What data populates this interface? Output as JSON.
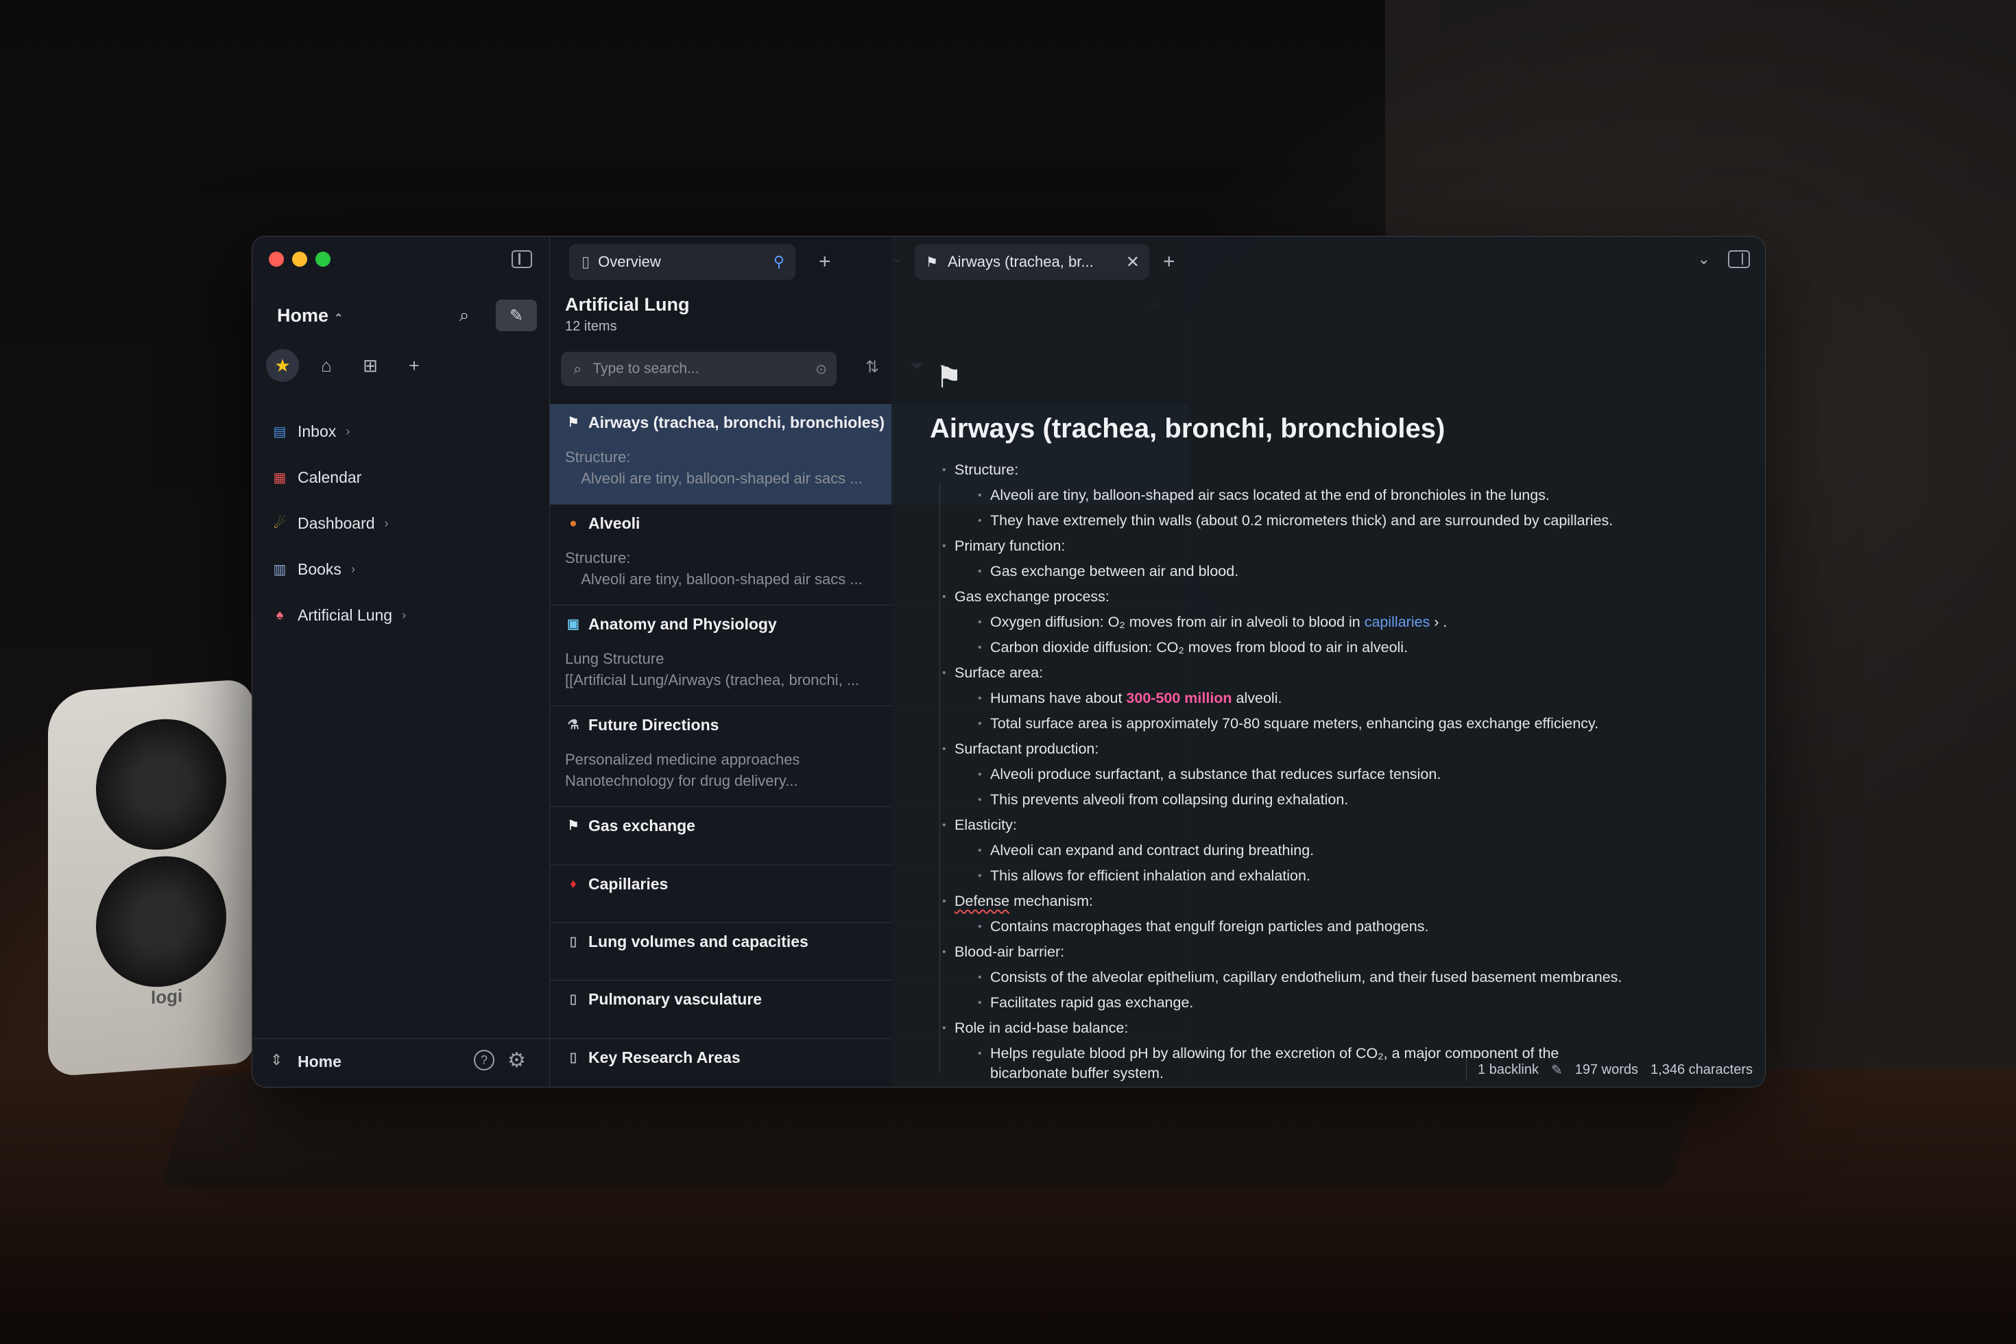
{
  "sidebar": {
    "title": "Home",
    "quick_icons": [
      "star-icon",
      "home-icon",
      "grid-icon",
      "plus-icon"
    ],
    "items": [
      {
        "label": "Inbox",
        "icon": "inbox-icon"
      },
      {
        "label": "Calendar",
        "icon": "calendar-icon"
      },
      {
        "label": "Dashboard",
        "icon": "dashboard-icon"
      },
      {
        "label": "Books",
        "icon": "book-icon"
      },
      {
        "label": "Artificial Lung",
        "icon": "lungs-icon"
      }
    ],
    "footer_label": "Home"
  },
  "middle": {
    "tab_label": "Overview",
    "list_title": "Artificial Lung",
    "list_count": "12 items",
    "search_placeholder": "Type to search...",
    "notes": [
      {
        "title": "Airways (trachea, bronchi, bronchioles)",
        "preview": "Structure:\n    Alveoli are tiny, balloon-shaped air sacs ...",
        "icon": "flag-icon"
      },
      {
        "title": "Alveoli",
        "preview": "Structure:\n    Alveoli are tiny, balloon-shaped air sacs ...",
        "icon": "orange-dot-icon"
      },
      {
        "title": "Anatomy and Physiology",
        "preview": "Lung Structure\n[[Artificial Lung/Airways (trachea, bronchi, ...",
        "icon": "anatomy-icon"
      },
      {
        "title": "Future Directions",
        "preview": "Personalized medicine approaches\nNanotechnology for drug delivery...",
        "icon": "microscope-icon"
      },
      {
        "title": "Gas exchange",
        "preview": "",
        "icon": "flag-icon"
      },
      {
        "title": "Capillaries",
        "preview": "",
        "icon": "drop-icon"
      },
      {
        "title": "Lung volumes and capacities",
        "preview": "",
        "icon": "document-icon"
      },
      {
        "title": "Pulmonary vasculature",
        "preview": "",
        "icon": "document-icon"
      },
      {
        "title": "Key Research Areas",
        "preview": "",
        "icon": "document-icon"
      }
    ]
  },
  "editor": {
    "tab_label": "Airways (trachea, br...",
    "title": "Airways (trachea, bronchi, bronchioles)",
    "outline": [
      {
        "level": 1,
        "text": "Structure:"
      },
      {
        "level": 2,
        "text": "Alveoli are tiny, balloon-shaped air sacs located at the end of bronchioles in the lungs."
      },
      {
        "level": 2,
        "text": "They have extremely thin walls (about 0.2 micrometers thick) and are surrounded by capillaries."
      },
      {
        "level": 1,
        "text": "Primary function:"
      },
      {
        "level": 2,
        "text": "Gas exchange between air and blood."
      },
      {
        "level": 1,
        "text": "Gas exchange process:"
      },
      {
        "level": 2,
        "text": "Oxygen diffusion: O₂ moves from air in alveoli to blood in ",
        "link": "capillaries",
        "after": " ›  ."
      },
      {
        "level": 2,
        "text": "Carbon dioxide diffusion: CO₂ moves from blood to air in alveoli."
      },
      {
        "level": 1,
        "text": "Surface area:"
      },
      {
        "level": 2,
        "text": "Humans have about ",
        "highlight": "300-500 million",
        "after": " alveoli."
      },
      {
        "level": 2,
        "text": "Total surface area is approximately 70-80 square meters, enhancing gas exchange efficiency."
      },
      {
        "level": 1,
        "text": "Surfactant production:"
      },
      {
        "level": 2,
        "text": "Alveoli produce surfactant, a substance that reduces surface tension."
      },
      {
        "level": 2,
        "text": "This prevents alveoli from collapsing during exhalation."
      },
      {
        "level": 1,
        "text": "Elasticity:"
      },
      {
        "level": 2,
        "text": "Alveoli can expand and contract during breathing."
      },
      {
        "level": 2,
        "text": "This allows for efficient inhalation and exhalation."
      },
      {
        "level": 1,
        "underline": "Defense",
        "text": " mechanism:"
      },
      {
        "level": 2,
        "text": "Contains macrophages that engulf foreign particles and pathogens."
      },
      {
        "level": 1,
        "text": "Blood-air barrier:"
      },
      {
        "level": 2,
        "text": "Consists of the alveolar epithelium, capillary endothelium, and their fused basement membranes."
      },
      {
        "level": 2,
        "text": "Facilitates rapid gas exchange."
      },
      {
        "level": 1,
        "text": "Role in acid-base balance:"
      },
      {
        "level": 2,
        "text": "Helps regulate blood pH by allowing for the excretion of CO₂, a major component of the"
      },
      {
        "level": 2,
        "text": "bicarbonate buffer system.",
        "continuation": true
      }
    ],
    "status": {
      "backlinks": "1 backlink",
      "words": "197 words",
      "chars": "1,346 characters"
    }
  },
  "colors": {
    "link": "#6a9cf0",
    "highlight": "#ff5a9a",
    "selected_row": "#2d3d57"
  }
}
